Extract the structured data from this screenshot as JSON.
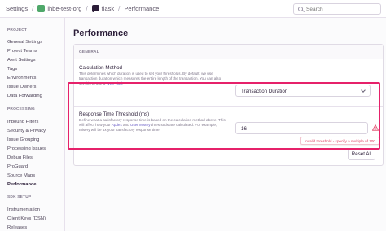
{
  "breadcrumb": {
    "settings": "Settings",
    "org": "ihbe-test-org",
    "project": "flask",
    "page": "Performance"
  },
  "search": {
    "placeholder": "Search"
  },
  "sidebar": {
    "sections": [
      {
        "title": "PROJECT",
        "items": [
          "General Settings",
          "Project Teams",
          "Alert Settings",
          "Tags",
          "Environments",
          "Issue Owners",
          "Data Forwarding"
        ]
      },
      {
        "title": "PROCESSING",
        "items": [
          "Inbound Filters",
          "Security & Privacy",
          "Issue Grouping",
          "Processing Issues",
          "Debug Files",
          "ProGuard",
          "Source Maps",
          "Performance"
        ]
      },
      {
        "title": "SDK SETUP",
        "items": [
          "Instrumentation",
          "Client Keys (DSN)",
          "Releases"
        ]
      }
    ],
    "active": "Performance"
  },
  "main": {
    "title": "Performance",
    "panel_header": "GENERAL",
    "calc": {
      "label": "Calculation Method",
      "help_prefix": "This determines which duration is used to set your thresholds. By default, we use transaction duration which measures the entire length of the transaction. You can also set this to use a ",
      "help_link": "Web Vital",
      "help_suffix": ".",
      "value": "Transaction Duration"
    },
    "threshold": {
      "label": "Response Time Threshold (ms)",
      "help_prefix": "Define what a satisfactory response time is based on the calculation method above. This will affect how your ",
      "help_link1": "Apdex",
      "help_mid": " and ",
      "help_link2": "User Misery",
      "help_suffix": " thresholds are calculated. For example, misery will be 4x your satisfactory response time.",
      "value": "16",
      "error": "Invalid threshold - specify a multiple of 100"
    },
    "reset_label": "Reset All"
  },
  "colors": {
    "accent": "#6c5fc7",
    "highlight": "#e6216a",
    "error": "#e03e62"
  }
}
